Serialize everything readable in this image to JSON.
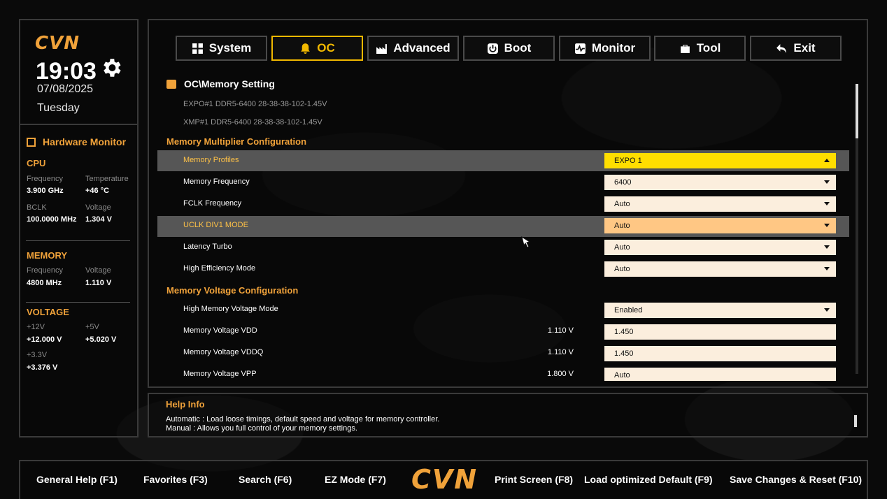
{
  "brand": {
    "logo": "CVN",
    "accent": "#f0a23a",
    "active_yellow": "#ffde00"
  },
  "clock": {
    "time": "19:03",
    "date": "07/08/2025",
    "weekday": "Tuesday"
  },
  "hardware_monitor": {
    "title": "Hardware Monitor",
    "cpu": {
      "title": "CPU",
      "frequency_label": "Frequency",
      "frequency": "3.900 GHz",
      "temperature_label": "Temperature",
      "temperature": "+46 °C",
      "bclk_label": "BCLK",
      "bclk": "100.0000 MHz",
      "voltage_label": "Voltage",
      "voltage": "1.304 V"
    },
    "memory": {
      "title": "MEMORY",
      "frequency_label": "Frequency",
      "frequency": "4800 MHz",
      "voltage_label": "Voltage",
      "voltage": "1.110 V"
    },
    "voltage": {
      "title": "VOLTAGE",
      "v12_label": "+12V",
      "v12": "+12.000 V",
      "v5_label": "+5V",
      "v5": "+5.020 V",
      "v33_label": "+3.3V",
      "v33": "+3.376 V"
    }
  },
  "tabs": [
    {
      "label": "System",
      "icon": "grid-icon"
    },
    {
      "label": "OC",
      "icon": "bell-icon",
      "active": true
    },
    {
      "label": "Advanced",
      "icon": "factory-icon"
    },
    {
      "label": "Boot",
      "icon": "power-icon"
    },
    {
      "label": "Monitor",
      "icon": "pulse-icon"
    },
    {
      "label": "Tool",
      "icon": "toolbox-icon"
    },
    {
      "label": "Exit",
      "icon": "back-arrow-icon"
    }
  ],
  "page": {
    "path": "OC\\Memory Setting",
    "expo_info": "EXPO#1 DDR5-6400 28-38-38-102-1.45V",
    "xmp_info": "XMP#1   DDR5-6400 28-38-38-102-1.45V"
  },
  "sections": {
    "multiplier": "Memory Multiplier Configuration",
    "voltage": "Memory Voltage Configuration"
  },
  "settings": [
    {
      "label": "Memory Profiles",
      "value": "EXPO 1"
    },
    {
      "label": "Memory Frequency",
      "value": "6400"
    },
    {
      "label": "FCLK Frequency",
      "value": "Auto"
    },
    {
      "label": "UCLK DIV1 MODE",
      "value": "Auto"
    },
    {
      "label": "Latency Turbo",
      "value": "Auto"
    },
    {
      "label": "High Efficiency Mode",
      "value": "Auto"
    },
    {
      "label": "High Memory Voltage Mode",
      "value": "Enabled"
    },
    {
      "label": "Memory Voltage VDD",
      "current": "1.110 V",
      "value": "1.450"
    },
    {
      "label": "Memory Voltage VDDQ",
      "current": "1.110 V",
      "value": "1.450"
    },
    {
      "label": "Memory Voltage VPP",
      "current": "1.800 V",
      "value": "Auto"
    }
  ],
  "help": {
    "title": "Help Info",
    "line1": "Automatic : Load loose timings, default speed and voltage for memory controller.",
    "line2": "Manual : Allows you full control of your memory settings."
  },
  "footer": {
    "general_help": "General Help (F1)",
    "favorites": "Favorites (F3)",
    "search": "Search (F6)",
    "ez_mode": "EZ Mode (F7)",
    "logo": "CVN",
    "print_screen": "Print Screen (F8)",
    "load_default": "Load optimized Default (F9)",
    "save_reset": "Save Changes & Reset (F10)"
  }
}
